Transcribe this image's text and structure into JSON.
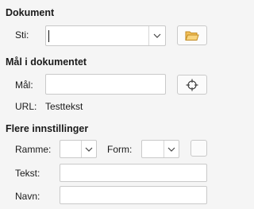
{
  "document": {
    "title": "Dokument",
    "path_label": "Sti:",
    "path_value": "",
    "open_icon": "folder-icon"
  },
  "target": {
    "title": "Mål i dokumentet",
    "target_label": "Mål:",
    "target_value": "",
    "target_icon": "crosshair-icon",
    "url_label": "URL:",
    "url_value": "Testtekst"
  },
  "more": {
    "title": "Flere innstillinger",
    "frame_label": "Ramme:",
    "frame_value": "",
    "form_label": "Form:",
    "form_value": "",
    "text_label": "Tekst:",
    "text_value": "",
    "name_label": "Navn:",
    "name_value": ""
  }
}
